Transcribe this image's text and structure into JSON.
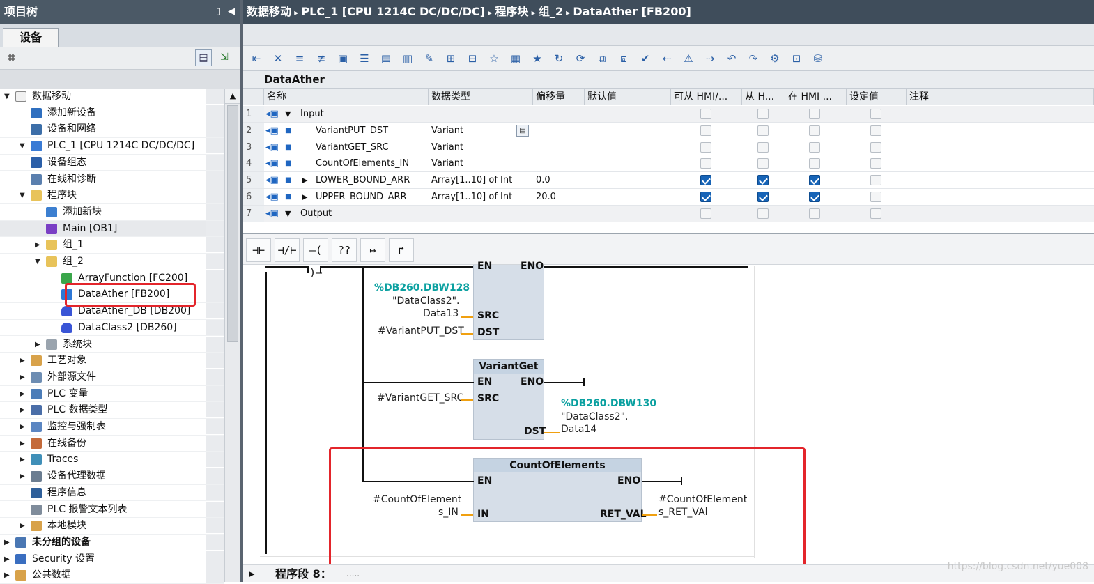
{
  "project_tree": {
    "title": "项目树",
    "tab": "设备",
    "items": [
      {
        "label": "数据移动",
        "level": 0,
        "toggle": "▼",
        "icon": "project-icon"
      },
      {
        "label": "添加新设备",
        "level": 1,
        "toggle": "",
        "icon": "add-device-icon"
      },
      {
        "label": "设备和网络",
        "level": 1,
        "toggle": "",
        "icon": "network-icon"
      },
      {
        "label": "PLC_1 [CPU 1214C DC/DC/DC]",
        "level": 1,
        "toggle": "▼",
        "icon": "plc-icon"
      },
      {
        "label": "设备组态",
        "level": 2,
        "toggle": "",
        "icon": "device-config-icon"
      },
      {
        "label": "在线和诊断",
        "level": 2,
        "toggle": "",
        "icon": "diagnostics-icon"
      },
      {
        "label": "程序块",
        "level": 2,
        "toggle": "▼",
        "icon": "folder-icon"
      },
      {
        "label": "添加新块",
        "level": 3,
        "toggle": "",
        "icon": "add-block-icon"
      },
      {
        "label": "Main [OB1]",
        "level": 3,
        "toggle": "",
        "icon": "ob-icon"
      },
      {
        "label": "组_1",
        "level": 3,
        "toggle": "▶",
        "icon": "group-folder-icon"
      },
      {
        "label": "组_2",
        "level": 3,
        "toggle": "▼",
        "icon": "group-folder-icon"
      },
      {
        "label": "ArrayFunction [FC200]",
        "level": 4,
        "toggle": "",
        "icon": "fc-icon"
      },
      {
        "label": "DataAther [FB200]",
        "level": 4,
        "toggle": "",
        "icon": "fb-icon"
      },
      {
        "label": "DataAther_DB [DB200]",
        "level": 4,
        "toggle": "",
        "icon": "db-icon"
      },
      {
        "label": "DataClass2 [DB260]",
        "level": 4,
        "toggle": "",
        "icon": "db-icon"
      },
      {
        "label": "系统块",
        "level": 3,
        "toggle": "▶",
        "icon": "system-folder-icon"
      },
      {
        "label": "工艺对象",
        "level": 2,
        "toggle": "▶",
        "icon": "tech-object-icon"
      },
      {
        "label": "外部源文件",
        "level": 2,
        "toggle": "▶",
        "icon": "source-file-icon"
      },
      {
        "label": "PLC 变量",
        "level": 2,
        "toggle": "▶",
        "icon": "plc-tags-icon"
      },
      {
        "label": "PLC 数据类型",
        "level": 2,
        "toggle": "▶",
        "icon": "plc-datatype-icon"
      },
      {
        "label": "监控与强制表",
        "level": 2,
        "toggle": "▶",
        "icon": "watch-table-icon"
      },
      {
        "label": "在线备份",
        "level": 2,
        "toggle": "▶",
        "icon": "backup-icon"
      },
      {
        "label": "Traces",
        "level": 2,
        "toggle": "▶",
        "icon": "traces-icon"
      },
      {
        "label": "设备代理数据",
        "level": 2,
        "toggle": "▶",
        "icon": "proxy-icon"
      },
      {
        "label": "程序信息",
        "level": 2,
        "toggle": "",
        "icon": "program-info-icon"
      },
      {
        "label": "PLC 报警文本列表",
        "level": 2,
        "toggle": "",
        "icon": "alarm-text-icon"
      },
      {
        "label": "本地模块",
        "level": 2,
        "toggle": "▶",
        "icon": "local-module-icon"
      },
      {
        "label": "未分组的设备",
        "level": 0,
        "toggle": "▶",
        "icon": "ungrouped-devices-icon"
      },
      {
        "label": "Security 设置",
        "level": 0,
        "toggle": "▶",
        "icon": "security-icon"
      },
      {
        "label": "公共数据",
        "level": 0,
        "toggle": "▶",
        "icon": "common-data-icon"
      }
    ]
  },
  "editor": {
    "breadcrumb": [
      "数据移动",
      "PLC_1 [CPU 1214C DC/DC/DC]",
      "程序块",
      "组_2",
      "DataAther [FB200]"
    ],
    "block_name": "DataAther",
    "columns": [
      "名称",
      "数据类型",
      "偏移量",
      "默认值",
      "可从 HMI/...",
      "从 H...",
      "在 HMI ...",
      "设定值",
      "注释"
    ],
    "rows": [
      {
        "n": "1",
        "name": "Input",
        "type": "",
        "offset": "",
        "section": true,
        "c1": false,
        "c2": false,
        "c3": false
      },
      {
        "n": "2",
        "name": "VariantPUT_DST",
        "type": "Variant",
        "offset": "",
        "section": false,
        "c1": false,
        "c2": false,
        "c3": false
      },
      {
        "n": "3",
        "name": "VariantGET_SRC",
        "type": "Variant",
        "offset": "",
        "section": false,
        "c1": false,
        "c2": false,
        "c3": false
      },
      {
        "n": "4",
        "name": "CountOfElements_IN",
        "type": "Variant",
        "offset": "",
        "section": false,
        "c1": false,
        "c2": false,
        "c3": false
      },
      {
        "n": "5",
        "name": "LOWER_BOUND_ARR",
        "type": "Array[1..10] of Int",
        "offset": "0.0",
        "section": false,
        "expand": true,
        "c1": true,
        "c2": true,
        "c3": true
      },
      {
        "n": "6",
        "name": "UPPER_BOUND_ARR",
        "type": "Array[1..10] of Int",
        "offset": "20.0",
        "section": false,
        "expand": true,
        "c1": true,
        "c2": true,
        "c3": true
      },
      {
        "n": "7",
        "name": "Output",
        "type": "",
        "offset": "",
        "section": true,
        "c1": false,
        "c2": false,
        "c3": false
      }
    ],
    "ladder_tools": [
      "⊣⊢",
      "⊣/⊢",
      "–( )–",
      "??",
      "↦",
      "↱"
    ],
    "blocks": {
      "put": {
        "en": "EN",
        "eno": "ENO",
        "src_pin": "SRC",
        "dst_pin": "DST",
        "src_addr": "%DB260.DBW128",
        "src_op1": "\"DataClass2\".",
        "src_op2": "Data13",
        "dst_op": "#VariantPUT_DST"
      },
      "get": {
        "title": "VariantGet",
        "en": "EN",
        "eno": "ENO",
        "src_pin": "SRC",
        "dst_pin": "DST",
        "src_op": "#VariantGET_SRC",
        "dst_addr": "%DB260.DBW130",
        "dst_op1": "\"DataClass2\".",
        "dst_op2": "Data14"
      },
      "count": {
        "title": "CountOfElements",
        "en": "EN",
        "eno": "ENO",
        "in_pin": "IN",
        "ret_pin": "RET_VAL",
        "in_op1": "#CountOfElement",
        "in_op2": "s_IN",
        "ret_op1": "#CountOfElement",
        "ret_op2": "s_RET_VAl"
      }
    },
    "segment": {
      "label": "程序段 8：",
      "dots": "....."
    }
  },
  "watermark": "https://blog.csdn.net/yue008",
  "colors": {
    "highlight_red": "#e3252b",
    "checkbox_blue": "#1764b7",
    "address_teal": "#0aa0a0"
  }
}
